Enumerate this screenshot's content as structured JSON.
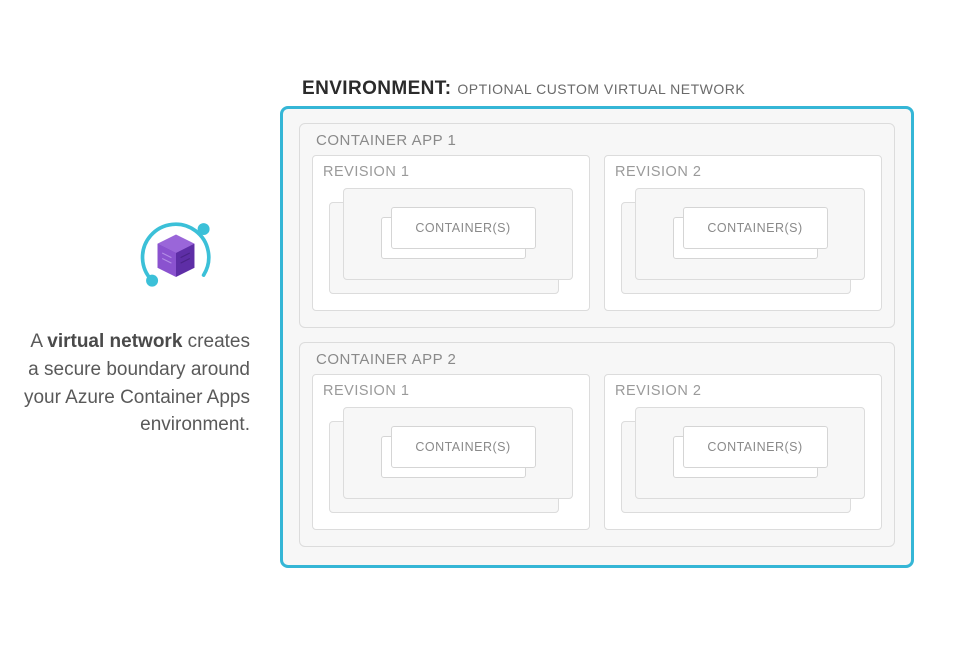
{
  "description": {
    "prefix": "A ",
    "bold": "virtual network",
    "suffix": " creates a secure boundary around your Azure Container Apps environment."
  },
  "environment": {
    "label": "ENVIRONMENT:",
    "subtitle": "OPTIONAL CUSTOM VIRTUAL NETWORK",
    "border_color": "#35b6d6",
    "apps": [
      {
        "title": "CONTAINER APP 1",
        "revisions": [
          {
            "title": "REVISION 1",
            "container_label": "CONTAINER(S)"
          },
          {
            "title": "REVISION 2",
            "container_label": "CONTAINER(S)"
          }
        ]
      },
      {
        "title": "CONTAINER APP 2",
        "revisions": [
          {
            "title": "REVISION 1",
            "container_label": "CONTAINER(S)"
          },
          {
            "title": "REVISION 2",
            "container_label": "CONTAINER(S)"
          }
        ]
      }
    ]
  },
  "icon": {
    "name": "virtual-network-icon",
    "accent": "#7b3fbf",
    "ring": "#3bc0d8"
  }
}
